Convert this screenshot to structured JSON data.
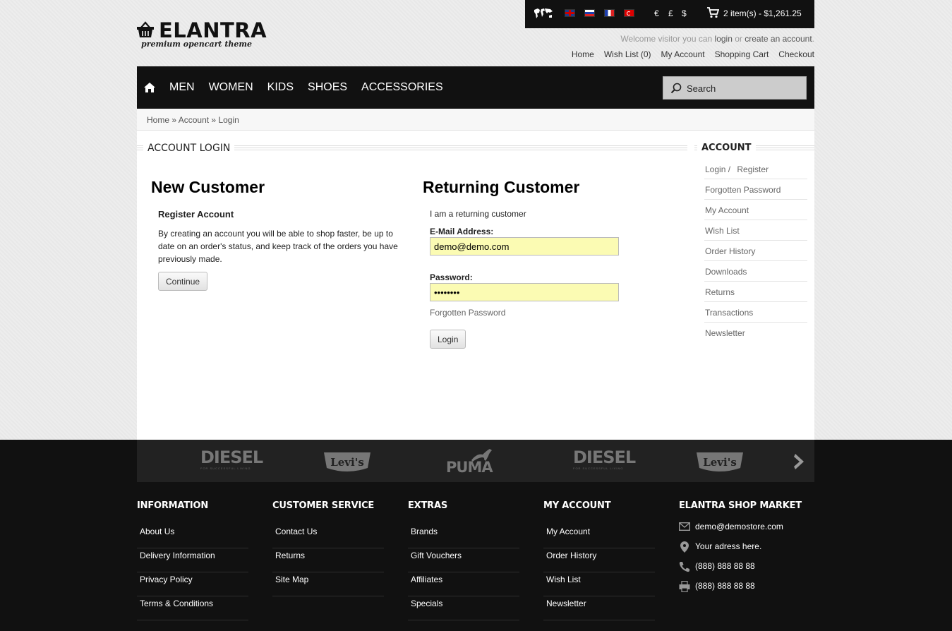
{
  "logo": {
    "name": "ELANTRA",
    "tagline": "premium opencart theme"
  },
  "top_strip": {
    "currencies": [
      "€",
      "£",
      "$"
    ],
    "cart_label": "2 item(s) - $1,261.25"
  },
  "welcome": {
    "prefix": "Welcome visitor you can",
    "login": "login",
    "or": "or",
    "register": "create an account",
    "end": "."
  },
  "top_links": [
    "Home",
    "Wish List (0)",
    "My Account",
    "Shopping Cart",
    "Checkout"
  ],
  "nav": {
    "items": [
      "MEN",
      "WOMEN",
      "KIDS",
      "SHOES",
      "ACCESSORIES"
    ],
    "search_placeholder": "Search"
  },
  "breadcrumb": {
    "home": "Home",
    "sep": "»",
    "account": "Account",
    "login": "Login"
  },
  "page": {
    "title": "ACCOUNT LOGIN"
  },
  "new_customer": {
    "heading": "New Customer",
    "subheading": "Register Account",
    "text": "By creating an account you will be able to shop faster, be up to date on an order's status, and keep track of the orders you have previously made.",
    "button": "Continue"
  },
  "returning_customer": {
    "heading": "Returning Customer",
    "intro": "I am a returning customer",
    "email_label": "E-Mail Address:",
    "email_value": "demo@demo.com",
    "password_label": "Password:",
    "password_value": "demodemo",
    "forgot": "Forgotten Password",
    "button": "Login"
  },
  "sidebar": {
    "title": "ACCOUNT",
    "items": [
      "Login /",
      "Register",
      "Forgotten Password",
      "My Account",
      "Wish List",
      "Order History",
      "Downloads",
      "Returns",
      "Transactions",
      "Newsletter"
    ]
  },
  "brands": [
    {
      "name": "DIESEL",
      "sub": "FOR SUCCESSFUL LIVING"
    },
    {
      "name": "Levi's"
    },
    {
      "name": "PUMA"
    },
    {
      "name": "DIESEL",
      "sub": "FOR SUCCESSFUL LIVING"
    },
    {
      "name": "Levi's"
    }
  ],
  "footer": {
    "information": {
      "title": "INFORMATION",
      "links": [
        "About Us",
        "Delivery Information",
        "Privacy Policy",
        "Terms & Conditions"
      ]
    },
    "customer_service": {
      "title": "CUSTOMER SERVICE",
      "links": [
        "Contact Us",
        "Returns",
        "Site Map"
      ]
    },
    "extras": {
      "title": "EXTRAS",
      "links": [
        "Brands",
        "Gift Vouchers",
        "Affiliates",
        "Specials"
      ]
    },
    "my_account": {
      "title": "MY ACCOUNT",
      "links": [
        "My Account",
        "Order History",
        "Wish List",
        "Newsletter"
      ]
    },
    "shop": {
      "title": "ELANTRA SHOP MARKET",
      "email": "demo@demostore.com",
      "address": "Your adress here.",
      "phone": "(888) 888 88 88",
      "fax": "(888) 888 88 88"
    }
  }
}
